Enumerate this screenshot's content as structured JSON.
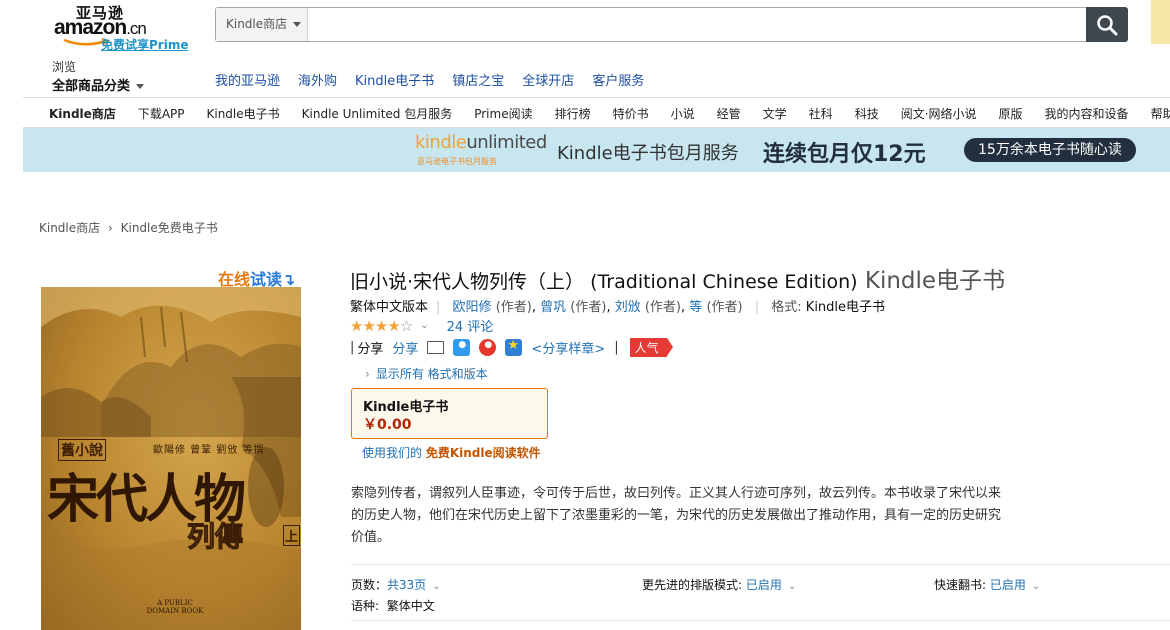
{
  "header": {
    "logo_cn": "亚马逊",
    "logo_en": "amazon",
    "logo_suffix": ".cn",
    "prime_link": "免费试享Prime",
    "search_category": "Kindle商店",
    "search_placeholder": "",
    "browse_small": "浏览",
    "browse_big": "全部商品分类",
    "nav": [
      "我的亚马逊",
      "海外购",
      "Kindle电子书",
      "镇店之宝",
      "全球开店",
      "客户服务"
    ]
  },
  "subnav": [
    "Kindle商店",
    "下载APP",
    "Kindle电子书",
    "Kindle Unlimited 包月服务",
    "Prime阅读",
    "排行榜",
    "特价书",
    "小说",
    "经管",
    "文学",
    "社科",
    "科技",
    "阅文·网络小说",
    "原版",
    "我的内容和设备",
    "帮助"
  ],
  "banner": {
    "ku_kindle": "kindle",
    "ku_unlimited": "unlimited",
    "ku_sub": "亚马逊电子书包月服务",
    "text1": "Kindle电子书包月服务",
    "text2": "连续包月仅12元",
    "pill": "15万余本电子书随心读"
  },
  "breadcrumb": {
    "item1": "Kindle商店",
    "sep": "›",
    "item2": "Kindle免费电子书"
  },
  "cover": {
    "look_inside_a": "在线",
    "look_inside_b": "试读",
    "look_inside_arrow": "↴",
    "tag": "舊小說",
    "authors": "歐陽修 曾鞏 劉攽 等撰",
    "title": "宋代人物",
    "sub": "列傳",
    "vol": "上",
    "pub": "A PUBLIC DOMAIN BOOK"
  },
  "product": {
    "title": "旧小说·宋代人物列传（上） (Traditional Chinese Edition)",
    "format": " Kindle电子书",
    "edition": "繁体中文版本",
    "authors": [
      {
        "name": "欧阳修",
        "role": "(作者)"
      },
      {
        "name": "曾巩",
        "role": "(作者)"
      },
      {
        "name": "刘攽",
        "role": "(作者)"
      },
      {
        "name": "等",
        "role": "(作者)"
      }
    ],
    "format_label": "格式:",
    "format_value": "Kindle电子书",
    "rating": 4,
    "stars_full": "★★★★",
    "stars_empty": "☆",
    "reviews": "24 评论",
    "share_label": "分享",
    "share_link": "分享",
    "share_sample": "<分享样章>",
    "hot": "人气",
    "formats_link": "显示所有 格式和版本",
    "price_format": "Kindle电子书",
    "price": "￥0.00",
    "reader_pre": "使用我们的 ",
    "reader_link": "免费Kindle阅读软件",
    "description": "索隐列传者，谓叙列人臣事迹，令可传于后世，故曰列传。正义其人行迹可序列，故云列传。本书收录了宋代以来的历史人物，他们在宋代历史上留下了浓墨重彩的一笔，为宋代的历史发展做出了推动作用，具有一定的历史研究价值。"
  },
  "meta": {
    "pages_label": "页数：",
    "pages_value": "共33页",
    "typesetting_label": "更先进的排版模式: ",
    "typesetting_value": "已启用",
    "pageflip_label": "快速翻书: ",
    "pageflip_value": "已启用",
    "language_label": "语种:",
    "language_value": "繁体中文"
  },
  "colors": {
    "accent_orange": "#e47911",
    "link_blue": "#1f6fb2",
    "price_red": "#b12704",
    "banner_bg": "#c7e6f0"
  }
}
